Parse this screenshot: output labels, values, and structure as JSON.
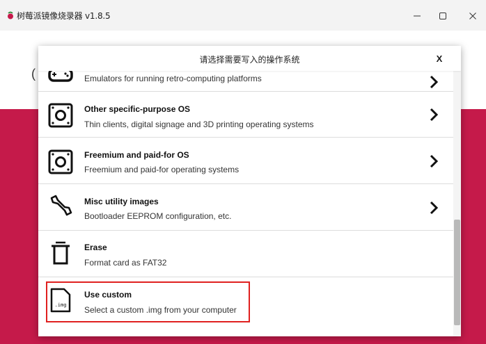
{
  "window": {
    "title": "树莓派镜像烧录器 v1.8.5",
    "controls": {
      "minimize": "—",
      "maximize": "☐",
      "close": "✕"
    }
  },
  "background": {
    "fragment": "(",
    "accent_color": "#c51a4a"
  },
  "dialog": {
    "title": "请选择需要写入的操作系统",
    "close_label": "X",
    "items": [
      {
        "name": "",
        "desc": "Emulators for running retro-computing platforms",
        "icon": "gamepad-icon",
        "has_arrow": true
      },
      {
        "name": "Other specific-purpose OS",
        "desc": "Thin clients, digital signage and 3D printing operating systems",
        "icon": "board-icon",
        "has_arrow": true
      },
      {
        "name": "Freemium and paid-for OS",
        "desc": "Freemium and paid-for operating systems",
        "icon": "board-icon",
        "has_arrow": true
      },
      {
        "name": "Misc utility images",
        "desc": "Bootloader EEPROM configuration, etc.",
        "icon": "wrench-icon",
        "has_arrow": true
      },
      {
        "name": "Erase",
        "desc": "Format card as FAT32",
        "icon": "trash-icon",
        "has_arrow": false
      },
      {
        "name": "Use custom",
        "desc": "Select a custom .img from your computer",
        "icon": "img-file-icon",
        "icon_text": ".img",
        "has_arrow": false
      }
    ]
  }
}
